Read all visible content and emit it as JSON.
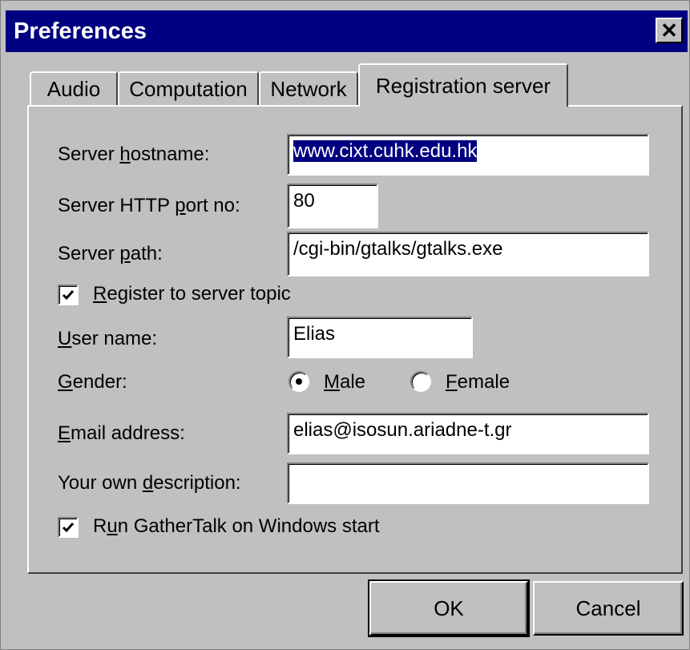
{
  "window": {
    "title": "Preferences"
  },
  "tabs": [
    {
      "label": "Audio"
    },
    {
      "label": "Computation"
    },
    {
      "label": "Network"
    },
    {
      "label": "Registration server"
    }
  ],
  "form": {
    "server_hostname": {
      "label_pre": "Server ",
      "label_mn": "h",
      "label_post": "ostname:",
      "value": "www.cixt.cuhk.edu.hk"
    },
    "server_port": {
      "label_pre": "Server HTTP ",
      "label_mn": "p",
      "label_post": "ort no:",
      "value": "80"
    },
    "server_path": {
      "label_pre": "Server ",
      "label_mn": "p",
      "label_post": "ath:",
      "value": "/cgi-bin/gtalks/gtalks.exe"
    },
    "register_topic": {
      "label_pre": "",
      "label_mn": "R",
      "label_post": "egister to server topic",
      "checked": true
    },
    "user_name": {
      "label_pre": "",
      "label_mn": "U",
      "label_post": "ser name:",
      "value": "Elias"
    },
    "gender": {
      "label_pre": "",
      "label_mn": "G",
      "label_post": "ender:",
      "options": [
        {
          "pre": "",
          "mn": "M",
          "post": "ale",
          "selected": true
        },
        {
          "pre": "",
          "mn": "F",
          "post": "emale",
          "selected": false
        }
      ]
    },
    "email": {
      "label_pre": "",
      "label_mn": "E",
      "label_post": "mail address:",
      "value": "elias@isosun.ariadne-t.gr"
    },
    "description": {
      "label_pre": "Your own ",
      "label_mn": "d",
      "label_post": "escription:",
      "value": ""
    },
    "run_on_start": {
      "label_pre": "R",
      "label_mn": "u",
      "label_post": "n GatherTalk on Windows start",
      "checked": true
    }
  },
  "buttons": {
    "ok": "OK",
    "cancel": "Cancel"
  },
  "icons": {
    "close": "close-icon",
    "check": "checkmark-icon"
  }
}
